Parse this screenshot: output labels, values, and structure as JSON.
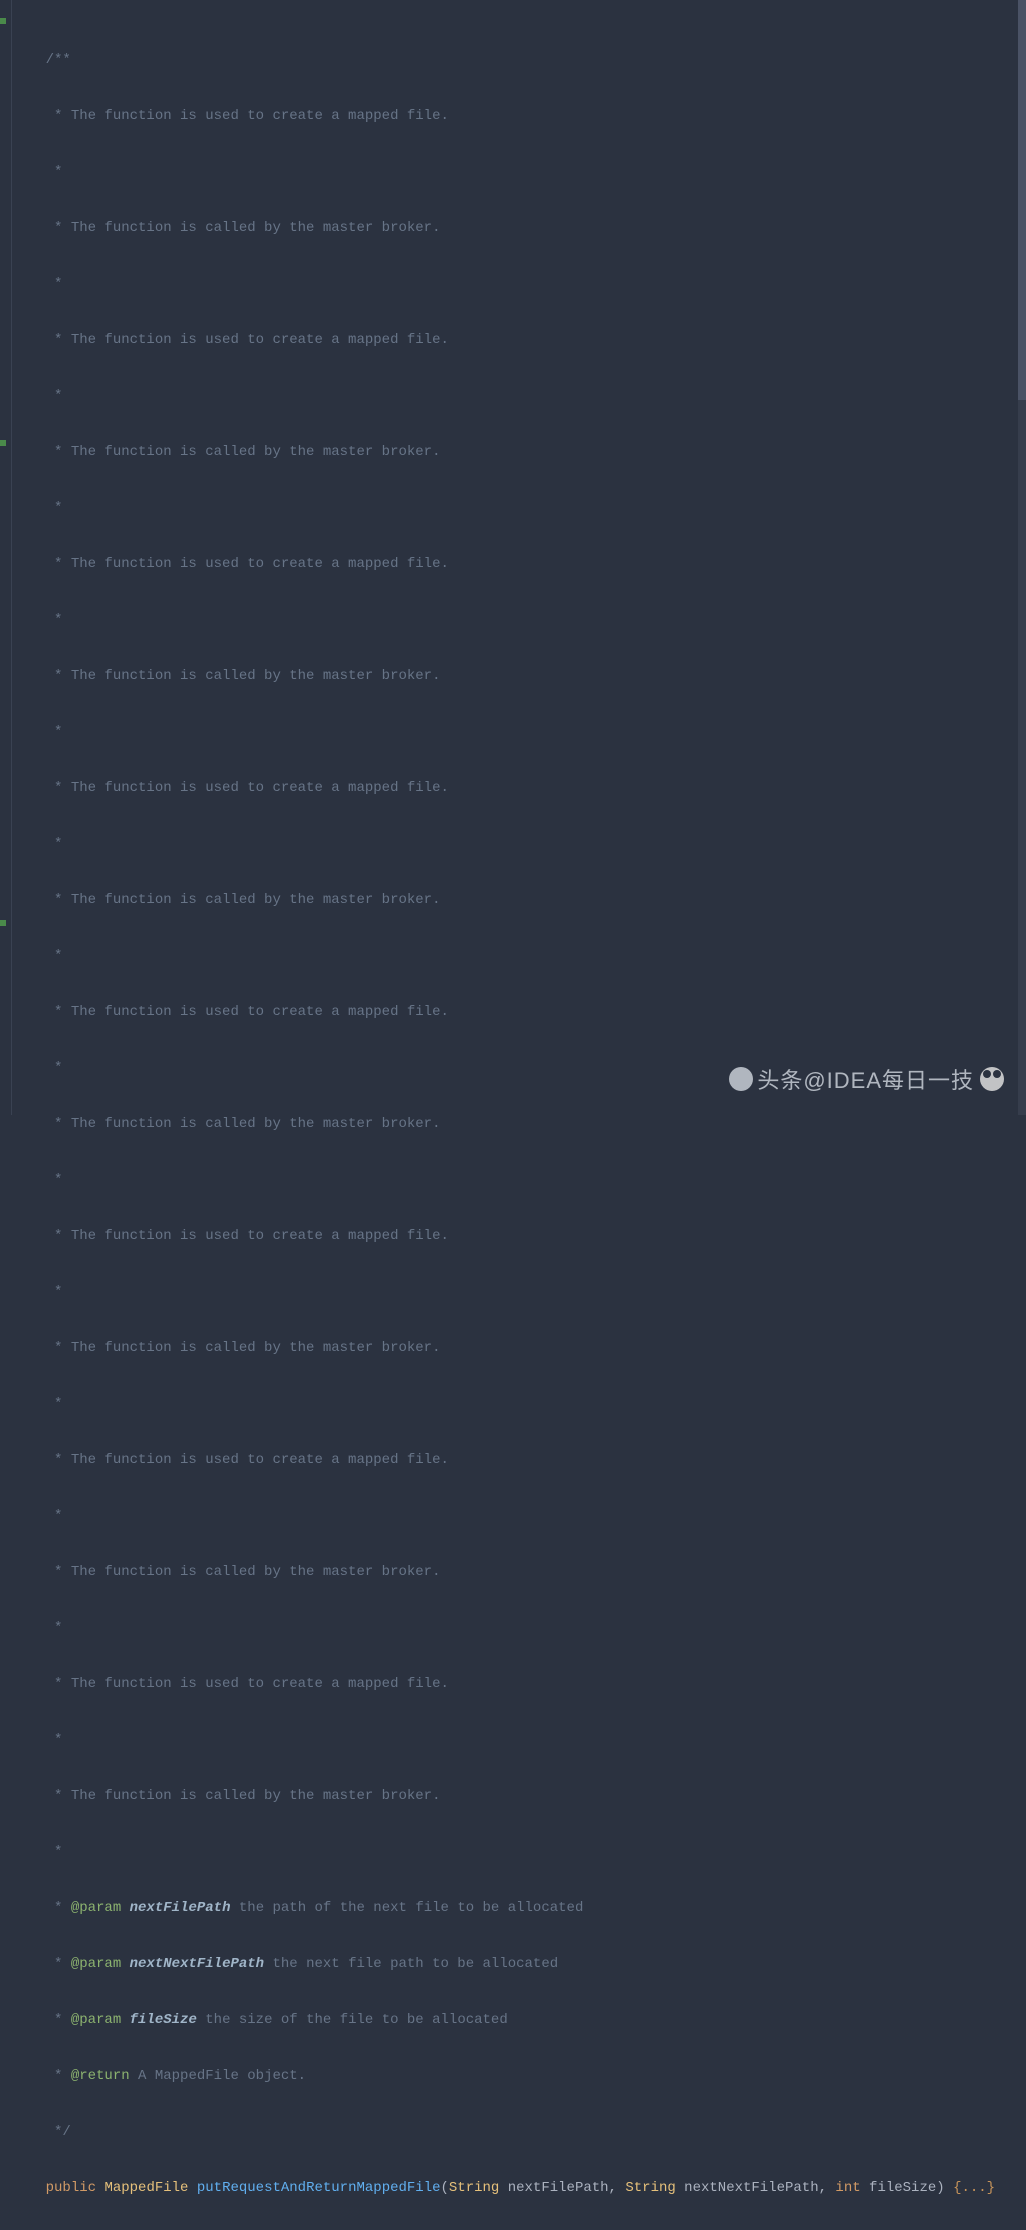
{
  "code": {
    "indent1": "    ",
    "indent2": "     ",
    "javadoc_open": "/**",
    "javadoc_close": " */",
    "star": " *",
    "desc_create": " * The function is used to create a mapped file.",
    "desc_master": " * The function is called by the master broker.",
    "param_tag": "@param",
    "return_tag": "@return",
    "p1_name": "nextFilePath",
    "p1_desc": " the path of the next file to be allocated",
    "p2_name": "nextNextFilePath",
    "p2_desc": " the next file path to be allocated",
    "p3_name": "fileSize",
    "p3_desc": " the size of the file to be allocated",
    "return_desc": " A MappedFile object.",
    "kw_public": "public",
    "kw_type": "MappedFile",
    "method": "putRequestAndReturnMappedFile",
    "paren_open": "(",
    "kw_string": "String",
    "var1": " nextFilePath, ",
    "var2": " nextNextFilePath, ",
    "kw_int": "int",
    "var3": " fileSize) ",
    "fold": "{...}"
  },
  "watermark": {
    "left": "头条@IDEA每日一技",
    "right": ""
  }
}
